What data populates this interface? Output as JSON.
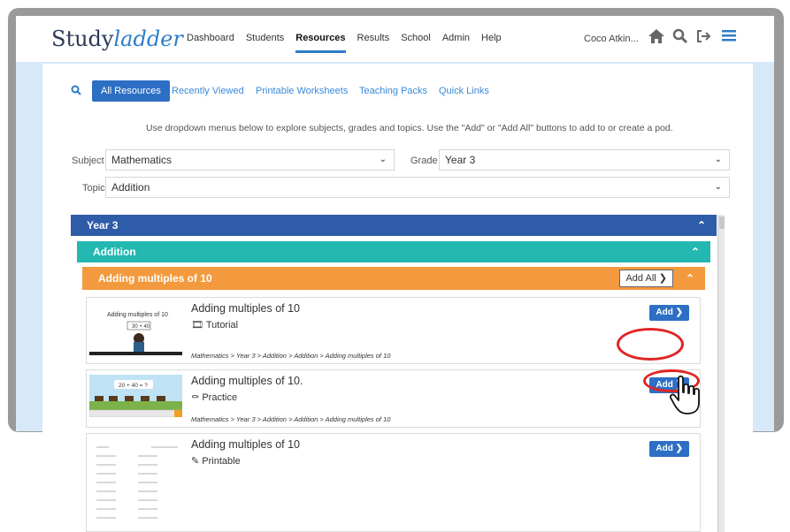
{
  "header": {
    "logo_study": "Study",
    "logo_ladder": "ladder",
    "nav": [
      "Dashboard",
      "Students",
      "Resources",
      "Results",
      "School",
      "Admin",
      "Help"
    ],
    "active_nav": "Resources",
    "user": "Coco Atkin...",
    "icons": [
      "home-icon",
      "search-icon",
      "logout-icon",
      "menu-icon"
    ]
  },
  "tabs": {
    "items": [
      "All Resources",
      "Recently Viewed",
      "Printable Worksheets",
      "Teaching Packs",
      "Quick Links"
    ],
    "active": "All Resources"
  },
  "help_text": "Use dropdown menus below to explore subjects, grades and topics. Use the \"Add\" or \"Add All\" buttons to add to or create a pod.",
  "filters": {
    "subject_label": "Subject",
    "subject_value": "Mathematics",
    "grade_label": "Grade",
    "grade_value": "Year 3",
    "topic_label": "Topic",
    "topic_value": "Addition"
  },
  "accordion": {
    "year": "Year 3",
    "topic": "Addition",
    "subtopic": "Adding multiples of 10",
    "add_all": "Add All"
  },
  "items": [
    {
      "title": "Adding multiples of 10",
      "kind": "Tutorial",
      "thumb_text": "Adding multiples of 10",
      "thumb_eq": "30 + 40",
      "crumb": "Mathematics > Year 3 > Addition > Addition > Adding multiples of 10",
      "add": "Add"
    },
    {
      "title": "Adding multiples of 10.",
      "kind": "Practice",
      "thumb_eq": "20 + 40 = ?",
      "crumb": "Mathematics > Year 3 > Addition > Addition > Adding multiples of 10",
      "add": "Add"
    },
    {
      "title": "Adding multiples of 10",
      "kind": "Printable",
      "add": "Add"
    }
  ],
  "colors": {
    "year": "#2e5ca8",
    "topic": "#23b8b0",
    "subtopic": "#f39a3e",
    "accent": "#2d6fc4",
    "annotation": "#e02424"
  }
}
